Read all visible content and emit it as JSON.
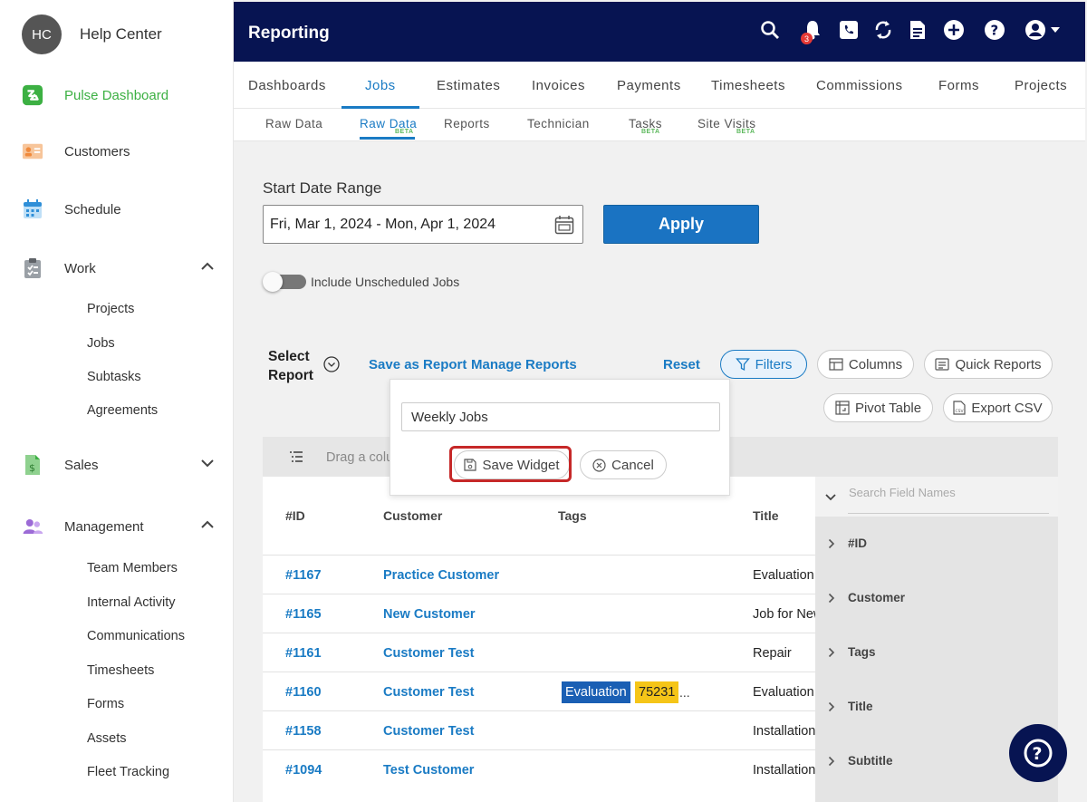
{
  "sidebar": {
    "avatar_initials": "HC",
    "user_name": "Help Center",
    "items": [
      {
        "label": "Pulse Dashboard",
        "icon": "pulse-icon",
        "color": "#3cb043"
      },
      {
        "label": "Customers",
        "icon": "contact-card-icon"
      },
      {
        "label": "Schedule",
        "icon": "calendar-icon"
      },
      {
        "label": "Work",
        "icon": "clipboard-icon",
        "expanded": true
      },
      {
        "label": "Sales",
        "icon": "dollar-doc-icon",
        "expanded": false
      },
      {
        "label": "Management",
        "icon": "people-icon",
        "expanded": true
      }
    ],
    "work_sub": [
      "Projects",
      "Jobs",
      "Subtasks",
      "Agreements"
    ],
    "management_sub": [
      "Team Members",
      "Internal Activity",
      "Communications",
      "Timesheets",
      "Forms",
      "Assets",
      "Fleet Tracking"
    ]
  },
  "topbar": {
    "title": "Reporting",
    "notification_count": "3",
    "icons": [
      "search-icon",
      "bell-icon",
      "phone-icon",
      "sync-icon",
      "document-icon",
      "add-icon",
      "help-icon",
      "account-icon"
    ]
  },
  "tabs": [
    "Dashboards",
    "Jobs",
    "Estimates",
    "Invoices",
    "Payments",
    "Timesheets",
    "Commissions",
    "Forms",
    "Projects"
  ],
  "active_tab": "Jobs",
  "subtabs": [
    {
      "label": "Raw Data",
      "beta": ""
    },
    {
      "label": "Raw Data",
      "beta": "BETA"
    },
    {
      "label": "Reports",
      "beta": ""
    },
    {
      "label": "Technician",
      "beta": ""
    },
    {
      "label": "Tasks",
      "beta": "BETA"
    },
    {
      "label": "Site Visits",
      "beta": "BETA"
    }
  ],
  "filters": {
    "date_label": "Start Date Range",
    "date_value": "Fri, Mar 1, 2024 - Mon, Apr 1, 2024",
    "apply_label": "Apply",
    "toggle_label": "Include Unscheduled Jobs",
    "toggle_on": false
  },
  "toolbar": {
    "select_report_line1": "Select",
    "select_report_line2": "Report",
    "save_as_report": "Save as Report",
    "manage_reports": "Manage Reports",
    "reset": "Reset",
    "filters": "Filters",
    "columns": "Columns",
    "quick_reports": "Quick Reports",
    "pivot_table": "Pivot Table",
    "export_csv": "Export CSV"
  },
  "popover": {
    "input_value": "Weekly Jobs",
    "save_label": "Save Widget",
    "cancel_label": "Cancel"
  },
  "grid": {
    "group_text": "Drag a colu",
    "headers": [
      "#ID",
      "Customer",
      "Tags",
      "Title"
    ],
    "rows": [
      {
        "id": "#1167",
        "customer": "Practice Customer",
        "title": "Evaluation"
      },
      {
        "id": "#1165",
        "customer": "New Customer",
        "title": "Job for New"
      },
      {
        "id": "#1161",
        "customer": "Customer Test",
        "title": "Repair"
      },
      {
        "id": "#1160",
        "customer": "Customer Test",
        "title": "Evaluation",
        "tags": [
          "Evaluation",
          "75231"
        ],
        "tags_more": "..."
      },
      {
        "id": "#1158",
        "customer": "Customer Test",
        "title": "Installation"
      },
      {
        "id": "#1094",
        "customer": "Test Customer",
        "title": "Installation"
      }
    ]
  },
  "field_panel": {
    "search_placeholder": "Search Field Names",
    "fields": [
      "#ID",
      "Customer",
      "Tags",
      "Title",
      "Subtitle"
    ]
  },
  "colors": {
    "navy": "#071452",
    "accent_blue": "#1a7bc4",
    "apply_blue": "#1a73c2",
    "highlight_red": "#c62828"
  }
}
